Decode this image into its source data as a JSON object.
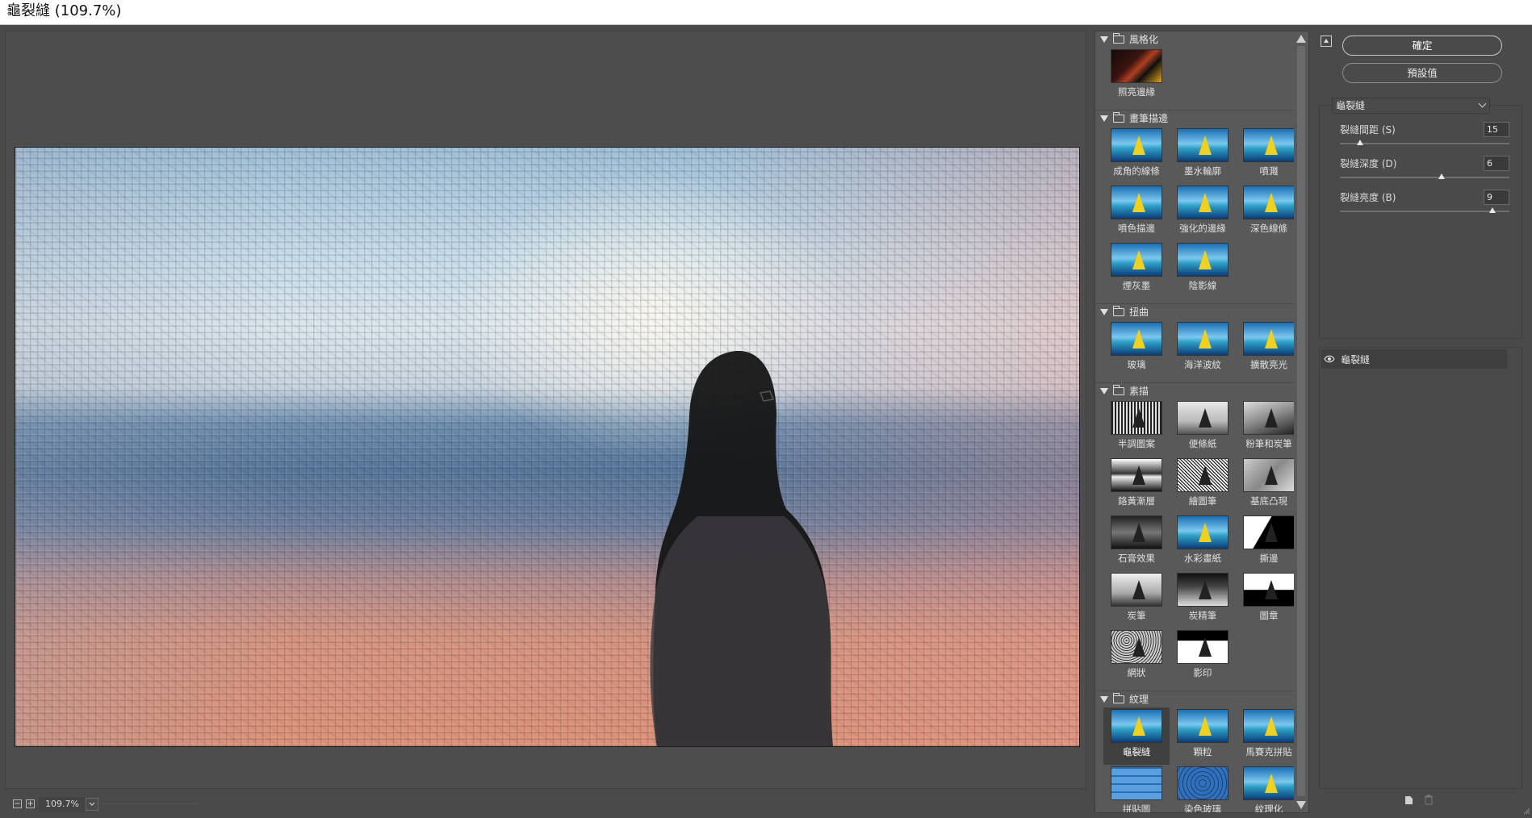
{
  "window": {
    "title": "龜裂縫 (109.7%)"
  },
  "preview": {
    "zoom": "109.7%"
  },
  "gallery": {
    "categories": [
      {
        "name": "風格化",
        "filters": [
          {
            "label": "照亮邊緣"
          }
        ]
      },
      {
        "name": "畫筆描邊",
        "filters": [
          {
            "label": "成角的線條"
          },
          {
            "label": "墨水輪廓"
          },
          {
            "label": "噴濺"
          },
          {
            "label": "噴色描邊"
          },
          {
            "label": "強化的邊緣"
          },
          {
            "label": "深色線條"
          },
          {
            "label": "煙灰墨"
          },
          {
            "label": "陰影線"
          }
        ]
      },
      {
        "name": "扭曲",
        "filters": [
          {
            "label": "玻璃"
          },
          {
            "label": "海洋波紋"
          },
          {
            "label": "擴散亮光"
          }
        ]
      },
      {
        "name": "素描",
        "filters": [
          {
            "label": "半調圖案"
          },
          {
            "label": "便條紙"
          },
          {
            "label": "粉筆和炭筆"
          },
          {
            "label": "鉻黃漸層"
          },
          {
            "label": "繪圖筆"
          },
          {
            "label": "基底凸現"
          },
          {
            "label": "石膏效果"
          },
          {
            "label": "水彩畫紙"
          },
          {
            "label": "撕邊"
          },
          {
            "label": "炭筆"
          },
          {
            "label": "炭精筆"
          },
          {
            "label": "圖章"
          },
          {
            "label": "網狀"
          },
          {
            "label": "影印"
          }
        ]
      },
      {
        "name": "紋理",
        "filters": [
          {
            "label": "龜裂縫"
          },
          {
            "label": "顆粒"
          },
          {
            "label": "馬賽克拼貼"
          },
          {
            "label": "拼貼圖"
          },
          {
            "label": "染色玻璃"
          },
          {
            "label": "紋理化"
          }
        ]
      }
    ],
    "selected": "龜裂縫"
  },
  "buttons": {
    "ok": "確定",
    "defaults": "預設值"
  },
  "settings": {
    "filter_name": "龜裂縫",
    "params": [
      {
        "label": "裂縫間距 (S)",
        "value": "15",
        "fraction": 0.12
      },
      {
        "label": "裂縫深度 (D)",
        "value": "6",
        "fraction": 0.6
      },
      {
        "label": "裂縫亮度 (B)",
        "value": "9",
        "fraction": 0.9
      }
    ]
  },
  "layers": {
    "items": [
      {
        "name": "龜裂縫"
      }
    ]
  },
  "colors": {
    "background": "#4a4a4a",
    "panel": "#595959",
    "selected": "#404040",
    "text": "#d8d8d8"
  }
}
